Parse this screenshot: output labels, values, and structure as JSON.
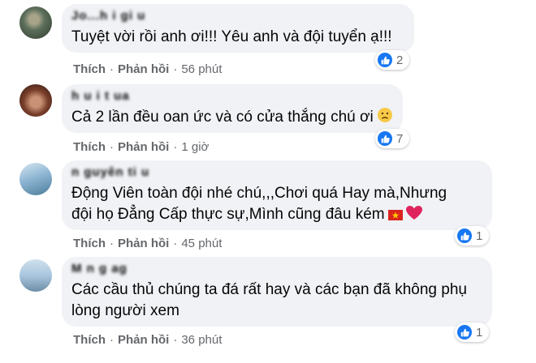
{
  "comments": [
    {
      "author": "Jo...h i gi u",
      "text": "Tuyệt vời rồi anh ơi!!! Yêu anh và đội tuyển ạ!!!",
      "emoji": "",
      "like_label": "Thích",
      "reply_label": "Phản hồi",
      "time": "56 phút",
      "reaction_count": "2",
      "avatar_colors": [
        "#5d6f5b",
        "#2f3a2e"
      ]
    },
    {
      "author": "h u i t ua",
      "text": "Cả 2 lần đều oan ức và có cửa thắng chú ơi",
      "emoji": "sad-face",
      "like_label": "Thích",
      "reply_label": "Phản hồi",
      "time": "1 giờ",
      "reaction_count": "7",
      "avatar_colors": [
        "#b06a4d",
        "#3c2418"
      ]
    },
    {
      "author": "n guyên ti u",
      "text": "Động Viên toàn đội nhé chú,,,Chơi quá Hay mà,Nhưng\nđội họ Đẳng Cấp thực sự,Mình cũng đâu kém",
      "emoji": "vn-flag-heart",
      "like_label": "Thích",
      "reply_label": "Phản hồi",
      "time": "45 phút",
      "reaction_count": "1",
      "avatar_colors": [
        "#8fb7d4",
        "#4a7b9a"
      ]
    },
    {
      "author": "M n g ag",
      "text": "Các cầu thủ chúng ta đá rất hay và các bạn đã không phụ\nlòng người xem",
      "emoji": "",
      "like_label": "Thích",
      "reply_label": "Phản hồi",
      "time": "36 phút",
      "reaction_count": "1",
      "avatar_colors": [
        "#a9c6de",
        "#6d8ea6"
      ]
    }
  ],
  "colors": {
    "bubble": "#f0f2f5",
    "meta_text": "#65676b",
    "like_blue": "#1877f2"
  }
}
